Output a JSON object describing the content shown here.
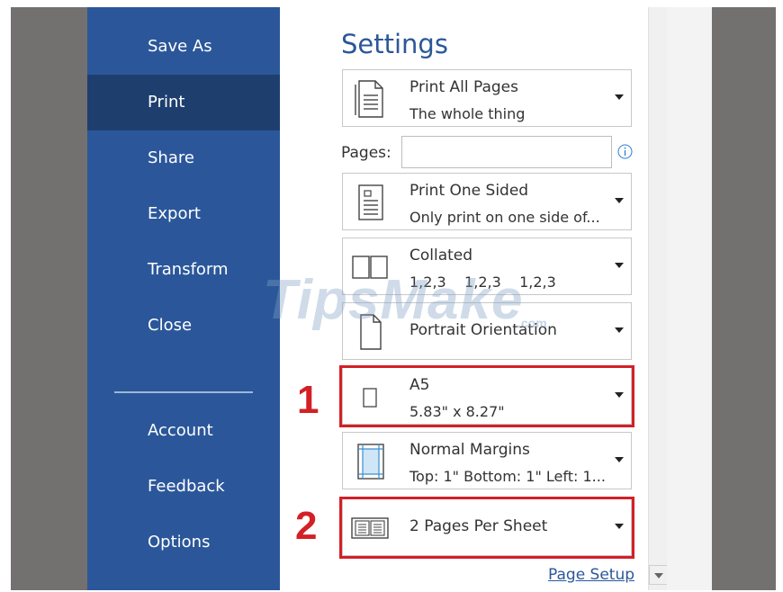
{
  "nav": {
    "items": [
      {
        "label": "Save As"
      },
      {
        "label": "Print",
        "active": true
      },
      {
        "label": "Share"
      },
      {
        "label": "Export"
      },
      {
        "label": "Transform"
      },
      {
        "label": "Close"
      },
      {
        "label": "Account"
      },
      {
        "label": "Feedback"
      },
      {
        "label": "Options"
      }
    ]
  },
  "settings": {
    "title": "Settings",
    "print_range": {
      "line1": "Print All Pages",
      "line2": "The whole thing"
    },
    "pages": {
      "label": "Pages:",
      "value": ""
    },
    "sides": {
      "line1": "Print One Sided",
      "line2": "Only print on one side of..."
    },
    "collation": {
      "line1": "Collated",
      "line2": "1,2,3    1,2,3    1,2,3"
    },
    "orientation": {
      "line1": "Portrait Orientation"
    },
    "paper_size": {
      "line1": "A5",
      "line2": "5.83\" x 8.27\""
    },
    "margins": {
      "line1": "Normal Margins",
      "line2": "Top: 1\" Bottom: 1\" Left: 1..."
    },
    "pages_per_sheet": {
      "line1": "2 Pages Per Sheet"
    },
    "page_setup_link": "Page Setup"
  },
  "annotations": {
    "marker1": "1",
    "marker2": "2"
  },
  "watermark": {
    "text": "TipsMake",
    "suffix": ".com"
  },
  "colors": {
    "sidebar": "#2b579a",
    "sidebar_active": "#1e3f6e",
    "highlight": "#d32027",
    "link": "#2b579a"
  }
}
